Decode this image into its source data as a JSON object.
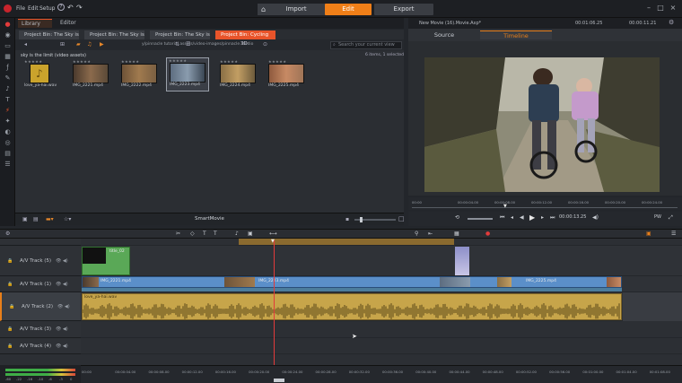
{
  "app": {
    "menu": [
      "File",
      "Edit",
      "Setup"
    ],
    "modes": [
      {
        "label": "Import",
        "active": false
      },
      {
        "label": "Edit",
        "active": true
      },
      {
        "label": "Export",
        "active": false
      }
    ],
    "project_title": "New Movie (16).Movie.Axp*",
    "project_timecode": "00:01:06.25",
    "project_duration": "00:00:11.21"
  },
  "library": {
    "tabs": [
      "Library",
      "Editor"
    ],
    "bins": [
      {
        "label": "Project Bin: The Sky is...",
        "active": false
      },
      {
        "label": "Project Bin: The Sky is...",
        "active": false
      },
      {
        "label": "Project Bin: The Sky is...",
        "active": false
      },
      {
        "label": "Project Bin: Cycling",
        "active": true
      }
    ],
    "path": "y/pinnacle tutorial assets/video-images/pinnacle studio",
    "search_placeholder": "Search your current view",
    "view_toggle": "3D",
    "collection_title": "sky is the limit (video assets)",
    "counts": "6 items, 1 selected",
    "stars": "★★★★★",
    "items": [
      {
        "name": "love_ya-hai.wav",
        "kind": "audio"
      },
      {
        "name": "IMG_2221.mp4",
        "kind": "video"
      },
      {
        "name": "IMG_2222.mp4",
        "kind": "video"
      },
      {
        "name": "IMG_2223.mp4",
        "kind": "video"
      },
      {
        "name": "IMG_2224.mp4",
        "kind": "video"
      },
      {
        "name": "IMG_2225.mp4",
        "kind": "video"
      }
    ],
    "smartmovie_label": "SmartMovie"
  },
  "player": {
    "tabs": [
      "Source",
      "Timeline"
    ],
    "active_tab": "Timeline",
    "ruler": [
      "00:00",
      "00:00:04.00",
      "00:00:08.00",
      "00:00:12.00",
      "00:00:16.00",
      "00:00:20.00",
      "00:00:24.00"
    ],
    "position": "00:00:13.25",
    "pw_label": "PW"
  },
  "timeline": {
    "tracks": [
      {
        "name": "",
        "locked": false,
        "selected": false
      },
      {
        "name": "A/V Track (5)",
        "locked": false,
        "selected": false
      },
      {
        "name": "A/V Track (1)",
        "locked": false,
        "selected": false
      },
      {
        "name": "A/V Track (2)",
        "locked": false,
        "selected": true
      },
      {
        "name": "A/V Track (3)",
        "locked": false,
        "selected": false
      },
      {
        "name": "A/V Track (4)",
        "locked": false,
        "selected": false
      }
    ],
    "clips": {
      "title_clip": "title_02",
      "video_main": "IMG_2221.mp4",
      "video_mid": "IMG_2223.mp4",
      "video_end": "IMG_2225.mp4",
      "audio": "love_ya-hai.wav"
    },
    "ruler": [
      "00:00",
      "00:00:04.00",
      "00:00:08.00",
      "00:00:12.00",
      "00:00:16.00",
      "00:00:20.00",
      "00:00:24.00",
      "00:00:28.00",
      "00:00:32.00",
      "00:00:36.00",
      "00:00:40.00",
      "00:00:44.00",
      "00:00:48.00",
      "00:00:52.00",
      "00:00:56.00",
      "00:01:00.00",
      "00:01:04.00",
      "00:01:08.00"
    ],
    "vu_labels": [
      "-60",
      "-22",
      "-16",
      "-10",
      "-6",
      "-3",
      "0"
    ],
    "colors": {
      "accent": "#f07f18",
      "video_clip": "#5b8fc9",
      "audio_clip": "#c7a54a",
      "title_clip": "#5aa857",
      "playhead": "#e23b3b"
    }
  }
}
